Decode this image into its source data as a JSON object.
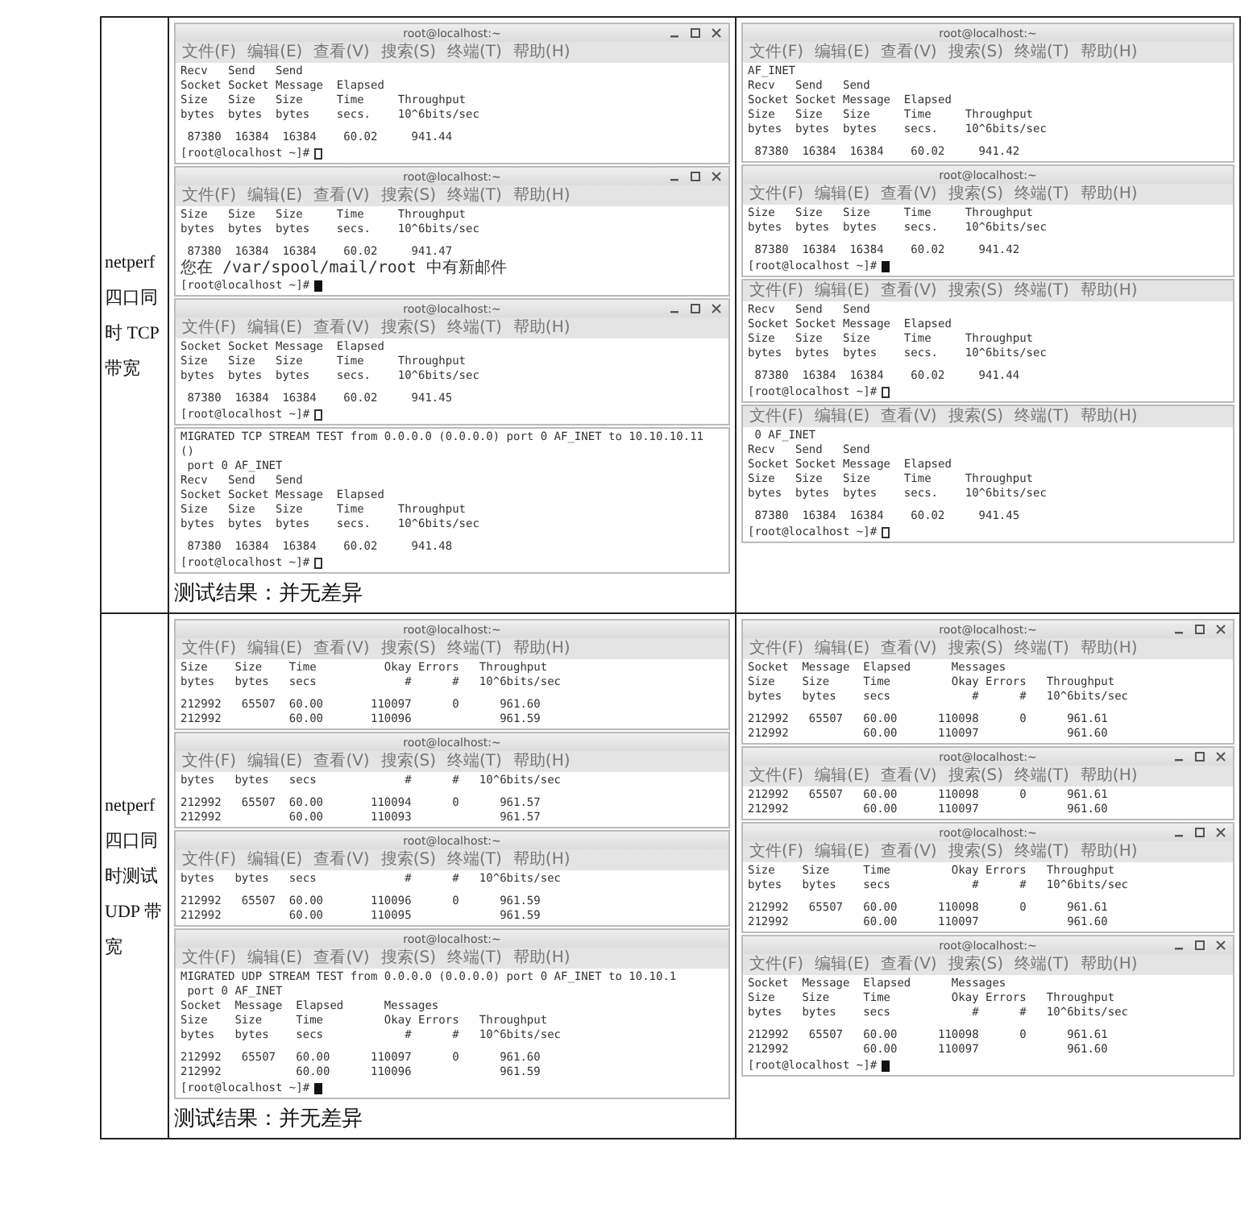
{
  "rows": [
    {
      "label": "netperf 四口同时 TCP 带宽",
      "cells": [
        {
          "windows": [
            {
              "title": "root@localhost:~",
              "controls": true,
              "menu": [
                "文件(F)",
                "编辑(E)",
                "查看(V)",
                "搜索(S)",
                "终端(T)",
                "帮助(H)"
              ],
              "blocks": [
                [
                  "Recv   Send   Send",
                  "Socket Socket Message  Elapsed",
                  "Size   Size   Size     Time     Throughput",
                  "bytes  bytes  bytes    secs.    10^6bits/sec"
                ],
                [
                  " 87380  16384  16384    60.02     941.44"
                ]
              ],
              "prompt": "[root@localhost ~]#",
              "cursor_filled": false
            },
            {
              "title": "root@localhost:~",
              "controls": true,
              "menu": [
                "文件(F)",
                "编辑(E)",
                "查看(V)",
                "搜索(S)",
                "终端(T)",
                "帮助(H)"
              ],
              "blocks": [
                [
                  "Size   Size   Size     Time     Throughput",
                  "bytes  bytes  bytes    secs.    10^6bits/sec"
                ],
                [
                  " 87380  16384  16384    60.02     941.47",
                  "您在 /var/spool/mail/root 中有新邮件"
                ]
              ],
              "prompt": "[root@localhost ~]#",
              "cursor_filled": true
            },
            {
              "title": "root@localhost:~",
              "controls": true,
              "menu": [
                "文件(F)",
                "编辑(E)",
                "查看(V)",
                "搜索(S)",
                "终端(T)",
                "帮助(H)"
              ],
              "blocks": [
                [
                  "Socket Socket Message  Elapsed",
                  "Size   Size   Size     Time     Throughput",
                  "bytes  bytes  bytes    secs.    10^6bits/sec"
                ],
                [
                  " 87380  16384  16384    60.02     941.45"
                ]
              ],
              "prompt": "[root@localhost ~]#",
              "cursor_filled": false
            },
            {
              "blocks": [
                [
                  "MIGRATED TCP STREAM TEST from 0.0.0.0 (0.0.0.0) port 0 AF_INET to 10.10.10.11 ()",
                  " port 0 AF_INET",
                  "Recv   Send   Send",
                  "Socket Socket Message  Elapsed",
                  "Size   Size   Size     Time     Throughput",
                  "bytes  bytes  bytes    secs.    10^6bits/sec"
                ],
                [
                  " 87380  16384  16384    60.02     941.48"
                ]
              ],
              "prompt": "[root@localhost ~]#",
              "cursor_filled": false
            }
          ],
          "caption": "测试结果：并无差异"
        },
        {
          "windows": [
            {
              "title": "root@localhost:~",
              "controls": false,
              "menu": [
                "文件(F)",
                "编辑(E)",
                "查看(V)",
                "搜索(S)",
                "终端(T)",
                "帮助(H)"
              ],
              "blocks": [
                [
                  "AF_INET",
                  "Recv   Send   Send",
                  "Socket Socket Message  Elapsed",
                  "Size   Size   Size     Time     Throughput",
                  "bytes  bytes  bytes    secs.    10^6bits/sec"
                ],
                [
                  " 87380  16384  16384    60.02     941.42"
                ]
              ]
            },
            {
              "title": "root@localhost:~",
              "controls": false,
              "menu": [
                "文件(F)",
                "编辑(E)",
                "查看(V)",
                "搜索(S)",
                "终端(T)",
                "帮助(H)"
              ],
              "blocks": [
                [
                  "Size   Size   Size     Time     Throughput",
                  "bytes  bytes  bytes    secs.    10^6bits/sec"
                ],
                [
                  " 87380  16384  16384    60.02     941.42"
                ]
              ],
              "prompt": "[root@localhost ~]#",
              "cursor_filled": true
            },
            {
              "menu": [
                "文件(F)",
                "编辑(E)",
                "查看(V)",
                "搜索(S)",
                "终端(T)",
                "帮助(H)"
              ],
              "blocks": [
                [
                  "Recv   Send   Send",
                  "Socket Socket Message  Elapsed",
                  "Size   Size   Size     Time     Throughput",
                  "bytes  bytes  bytes    secs.    10^6bits/sec"
                ],
                [
                  " 87380  16384  16384    60.02     941.44"
                ]
              ],
              "prompt": "[root@localhost ~]#",
              "cursor_filled": false
            },
            {
              "menu": [
                "文件(F)",
                "编辑(E)",
                "查看(V)",
                "搜索(S)",
                "终端(T)",
                "帮助(H)"
              ],
              "blocks": [
                [
                  " 0 AF_INET",
                  "Recv   Send   Send",
                  "Socket Socket Message  Elapsed",
                  "Size   Size   Size     Time     Throughput",
                  "bytes  bytes  bytes    secs.    10^6bits/sec"
                ],
                [
                  " 87380  16384  16384    60.02     941.45"
                ]
              ],
              "prompt": "[root@localhost ~]#",
              "cursor_filled": false
            }
          ]
        }
      ]
    },
    {
      "label": "netperf 四口同时测试 UDP 带宽",
      "cells": [
        {
          "windows": [
            {
              "title": "root@localhost:~",
              "controls": false,
              "menu": [
                "文件(F)",
                "编辑(E)",
                "查看(V)",
                "搜索(S)",
                "终端(T)",
                "帮助(H)"
              ],
              "blocks": [
                [
                  "Size    Size    Time          Okay Errors   Throughput",
                  "bytes   bytes   secs             #      #   10^6bits/sec"
                ],
                [
                  "212992   65507  60.00       110097      0      961.60",
                  "212992          60.00       110096             961.59"
                ]
              ]
            },
            {
              "title": "root@localhost:~",
              "controls": false,
              "menu": [
                "文件(F)",
                "编辑(E)",
                "查看(V)",
                "搜索(S)",
                "终端(T)",
                "帮助(H)"
              ],
              "blocks": [
                [
                  "bytes   bytes   secs             #      #   10^6bits/sec"
                ],
                [
                  "212992   65507  60.00       110094      0      961.57",
                  "212992          60.00       110093             961.57"
                ]
              ]
            },
            {
              "title": "root@localhost:~",
              "controls": false,
              "menu": [
                "文件(F)",
                "编辑(E)",
                "查看(V)",
                "搜索(S)",
                "终端(T)",
                "帮助(H)"
              ],
              "blocks": [
                [
                  "bytes   bytes   secs             #      #   10^6bits/sec"
                ],
                [
                  "212992   65507  60.00       110096      0      961.59",
                  "212992          60.00       110095             961.59"
                ]
              ]
            },
            {
              "title": "root@localhost:~",
              "controls": false,
              "menu": [
                "文件(F)",
                "编辑(E)",
                "查看(V)",
                "搜索(S)",
                "终端(T)",
                "帮助(H)"
              ],
              "blocks": [
                [
                  "MIGRATED UDP STREAM TEST from 0.0.0.0 (0.0.0.0) port 0 AF_INET to 10.10.1",
                  " port 0 AF_INET",
                  "Socket  Message  Elapsed      Messages",
                  "Size    Size     Time         Okay Errors   Throughput",
                  "bytes   bytes    secs            #      #   10^6bits/sec"
                ],
                [
                  "212992   65507   60.00      110097      0      961.60",
                  "212992           60.00      110096             961.59"
                ]
              ],
              "prompt": "[root@localhost ~]#",
              "cursor_filled": true
            }
          ],
          "caption": "测试结果：并无差异"
        },
        {
          "windows": [
            {
              "title": "root@localhost:~",
              "controls": true,
              "menu": [
                "文件(F)",
                "编辑(E)",
                "查看(V)",
                "搜索(S)",
                "终端(T)",
                "帮助(H)"
              ],
              "blocks": [
                [
                  "Socket  Message  Elapsed      Messages",
                  "Size    Size     Time         Okay Errors   Throughput",
                  "bytes   bytes    secs            #      #   10^6bits/sec"
                ],
                [
                  "212992   65507   60.00      110098      0      961.61",
                  "212992           60.00      110097             961.60"
                ]
              ]
            },
            {
              "title": "root@localhost:~",
              "controls": true,
              "menu": [
                "文件(F)",
                "编辑(E)",
                "查看(V)",
                "搜索(S)",
                "终端(T)",
                "帮助(H)"
              ],
              "blocks": [
                [
                  "212992   65507   60.00      110098      0      961.61",
                  "212992           60.00      110097             961.60"
                ]
              ]
            },
            {
              "title": "root@localhost:~",
              "controls": true,
              "menu": [
                "文件(F)",
                "编辑(E)",
                "查看(V)",
                "搜索(S)",
                "终端(T)",
                "帮助(H)"
              ],
              "blocks": [
                [
                  "Size    Size     Time         Okay Errors   Throughput",
                  "bytes   bytes    secs            #      #   10^6bits/sec"
                ],
                [
                  "212992   65507   60.00      110098      0      961.61",
                  "212992           60.00      110097             961.60"
                ]
              ]
            },
            {
              "title": "root@localhost:~",
              "controls": true,
              "menu": [
                "文件(F)",
                "编辑(E)",
                "查看(V)",
                "搜索(S)",
                "终端(T)",
                "帮助(H)"
              ],
              "blocks": [
                [
                  "Socket  Message  Elapsed      Messages",
                  "Size    Size     Time         Okay Errors   Throughput",
                  "bytes   bytes    secs            #      #   10^6bits/sec"
                ],
                [
                  "212992   65507   60.00      110098      0      961.61",
                  "212992           60.00      110097             961.60"
                ]
              ],
              "prompt": "[root@localhost ~]#",
              "cursor_filled": true
            }
          ]
        }
      ]
    }
  ]
}
